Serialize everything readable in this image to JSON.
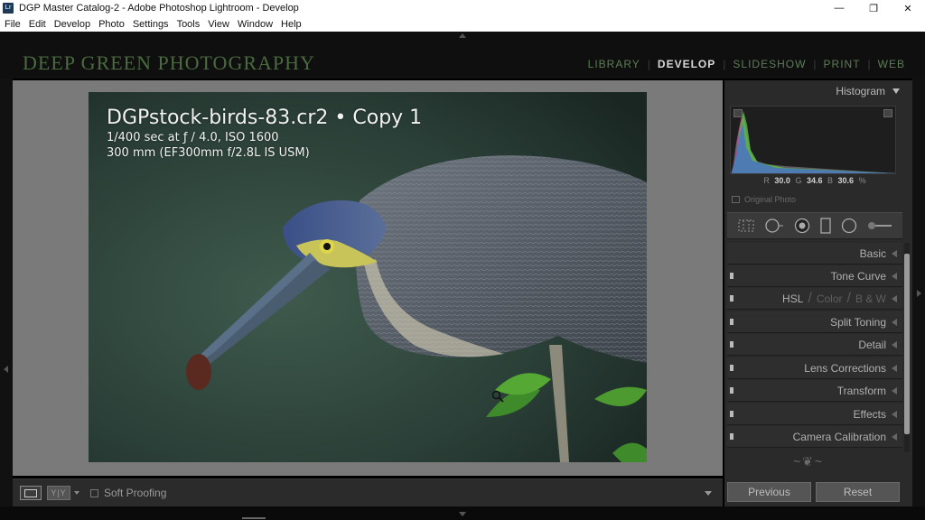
{
  "window": {
    "title": "DGP Master Catalog-2 - Adobe Photoshop Lightroom - Develop",
    "app_icon_text": "Lr",
    "minimize_glyph": "—",
    "maximize_glyph": "❐",
    "close_glyph": "✕"
  },
  "menu": [
    "File",
    "Edit",
    "Develop",
    "Photo",
    "Settings",
    "Tools",
    "View",
    "Window",
    "Help"
  ],
  "identity_plate": "DEEP GREEN PHOTOGRAPHY",
  "modules": [
    {
      "label": "LIBRARY",
      "active": false
    },
    {
      "label": "DEVELOP",
      "active": true
    },
    {
      "label": "SLIDESHOW",
      "active": false
    },
    {
      "label": "PRINT",
      "active": false
    },
    {
      "label": "WEB",
      "active": false
    }
  ],
  "module_separator": "|",
  "photo_info": {
    "title": "DGPstock-birds-83.cr2 • Copy 1",
    "exposure": "1/400 sec at ƒ / 4.0, ISO 1600",
    "lens": "300 mm (EF300mm f/2.8L IS USM)"
  },
  "toolbar": {
    "yy_label": "Y|Y",
    "soft_proofing": "Soft Proofing"
  },
  "histogram": {
    "title": "Histogram",
    "r_label": "R",
    "r_value": "30.0",
    "g_label": "G",
    "g_value": "34.6",
    "b_label": "B",
    "b_value": "30.6",
    "unit": "%",
    "original_photo": "Original Photo"
  },
  "tools": [
    "grid-overlay-icon",
    "crop-icon",
    "spot-removal-icon",
    "red-eye-icon",
    "graduated-filter-icon",
    "radial-filter-icon",
    "adjustment-brush-icon"
  ],
  "panels": {
    "basic": "Basic",
    "tone_curve": "Tone Curve",
    "hsl": "HSL",
    "color": "Color",
    "bw": "B & W",
    "hsl_sep": "/",
    "split_toning": "Split Toning",
    "detail": "Detail",
    "lens_corrections": "Lens Corrections",
    "transform": "Transform",
    "effects": "Effects",
    "camera_calibration": "Camera Calibration"
  },
  "ornament": "~❦~",
  "buttons": {
    "previous": "Previous",
    "reset": "Reset"
  },
  "colors": {
    "identity": "#4a6a3f",
    "module_inactive": "#5c7d54",
    "module_active": "#d8d8d8",
    "panel_bg": "#2a2a2a"
  }
}
